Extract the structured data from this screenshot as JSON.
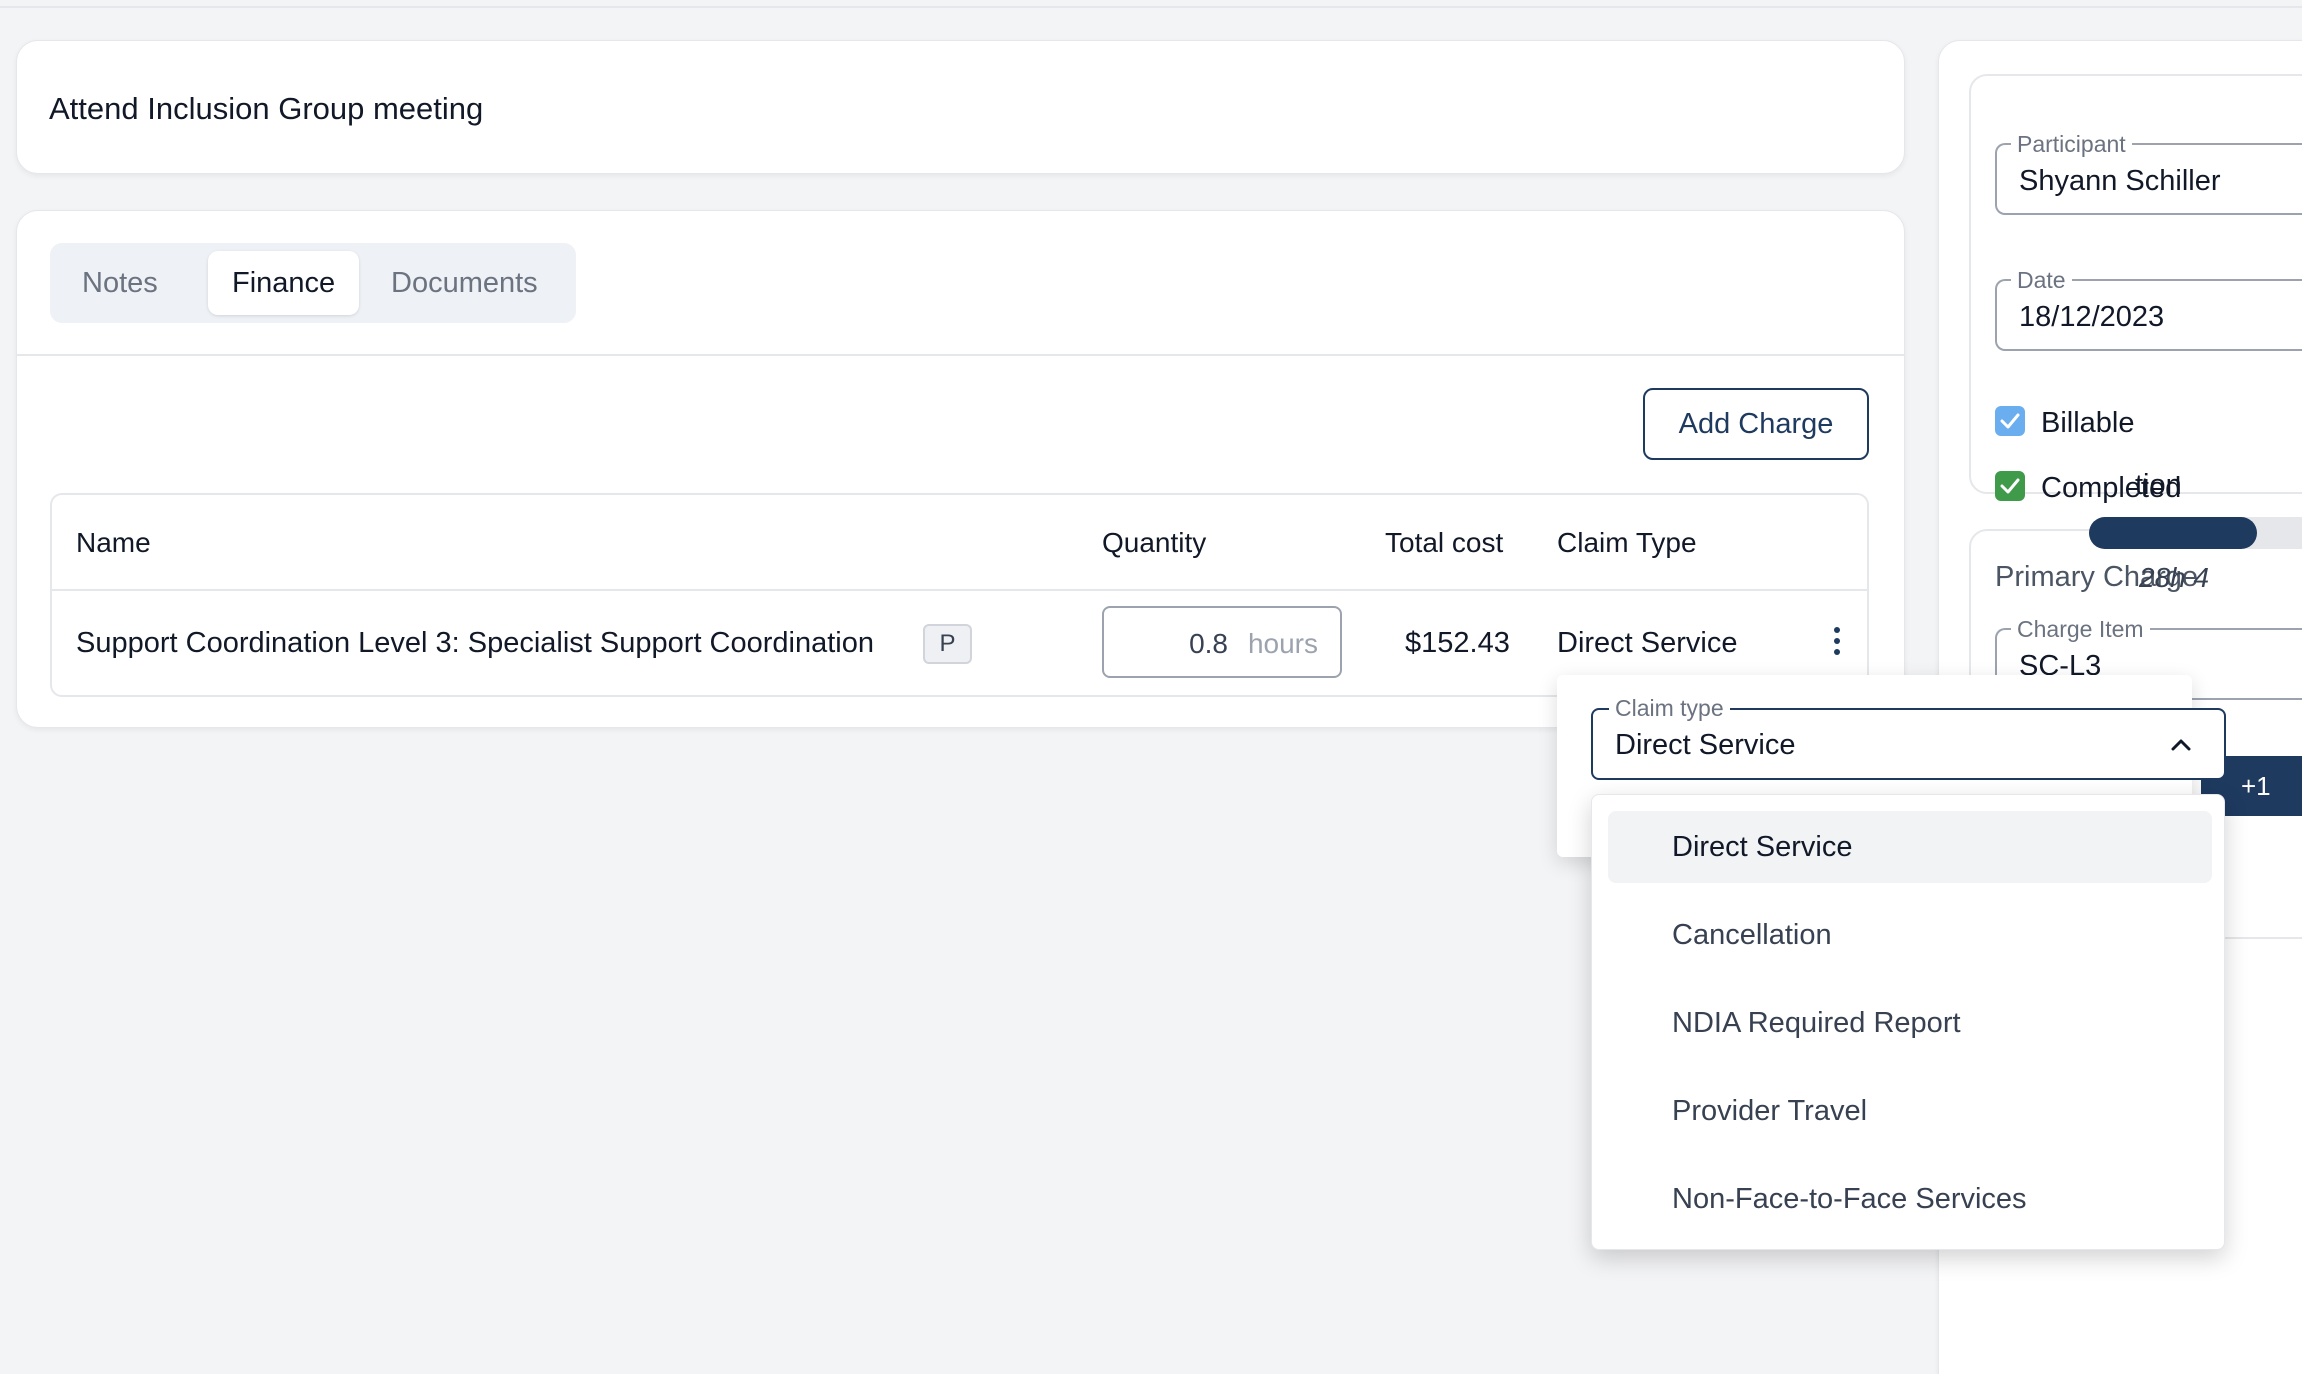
{
  "page": {
    "title": "Attend Inclusion Group meeting"
  },
  "tabs": [
    {
      "label": "Notes"
    },
    {
      "label": "Finance"
    },
    {
      "label": "Documents"
    }
  ],
  "finance": {
    "add_charge_label": "Add Charge",
    "columns": {
      "name": "Name",
      "quantity": "Quantity",
      "total_cost": "Total cost",
      "claim_type": "Claim Type"
    },
    "rows": [
      {
        "name": "Support Coordination Level 3: Specialist Support Coordination",
        "badge": "P",
        "quantity": "0.8",
        "unit": "hours",
        "total_cost": "$152.43",
        "claim_type": "Direct Service"
      }
    ]
  },
  "claim_dropdown": {
    "label": "Claim type",
    "value": "Direct Service",
    "options": [
      {
        "label": "Direct Service",
        "selected": true
      },
      {
        "label": "Cancellation"
      },
      {
        "label": "NDIA Required Report"
      },
      {
        "label": "Provider Travel"
      },
      {
        "label": "Non-Face-to-Face Services"
      }
    ]
  },
  "sidebar": {
    "participant_label": "Participant",
    "participant_value": "Shyann Schiller",
    "date_label": "Date",
    "date_value": "18/12/2023",
    "billable_label": "Billable",
    "billable_checked": true,
    "completed_label": "Completed",
    "completed_checked": true,
    "primary_charge_title": "Primary Charge",
    "charge_item_label": "Charge Item",
    "charge_item_value": "SC-L3",
    "button_partial": "+1",
    "partial_text": "tion",
    "progress_fraction": 0.7,
    "hours_partial": "28h 4"
  },
  "colors": {
    "primary": "#1e3a5f",
    "billable_check": "#6aaef0",
    "completed_check": "#3f9a4a"
  }
}
